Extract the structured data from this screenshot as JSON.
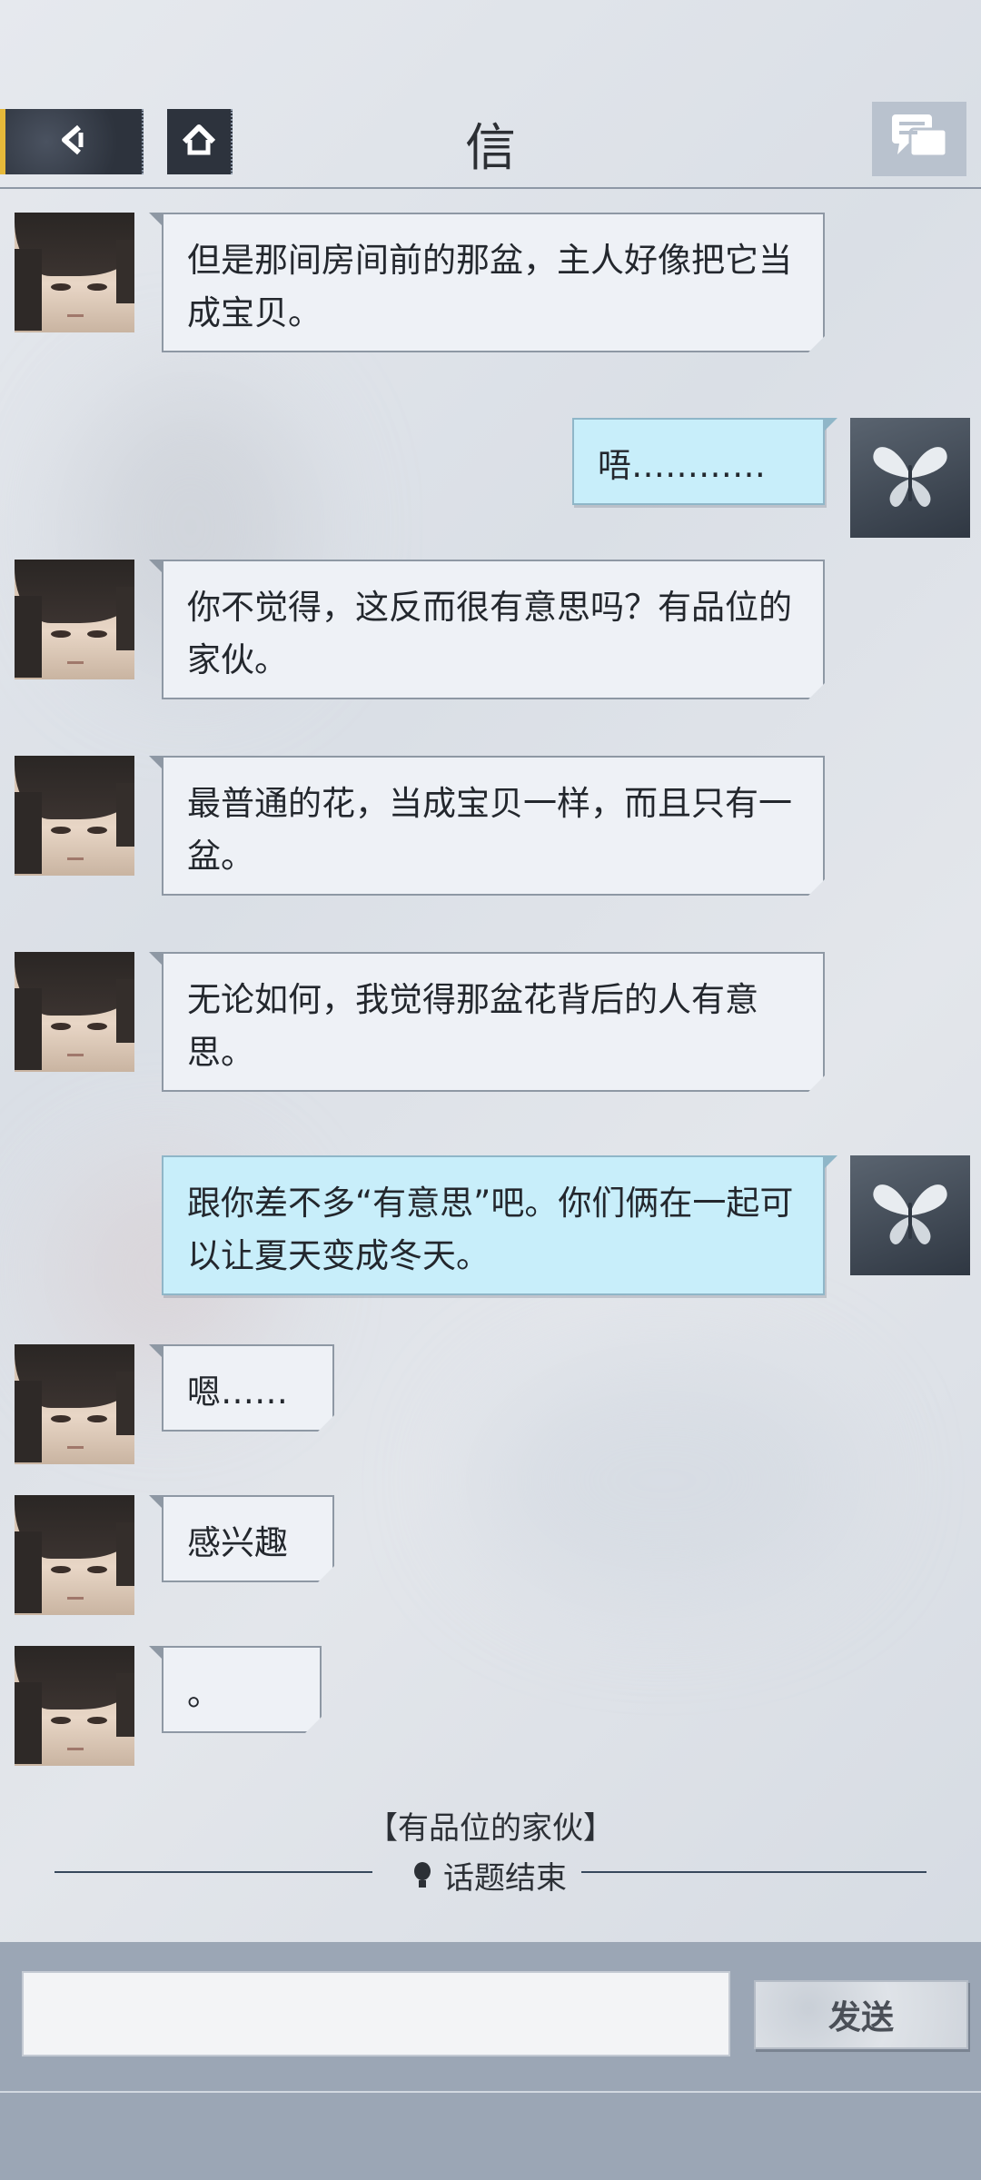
{
  "header": {
    "title": "信",
    "back_icon": "back-arrow-icon",
    "home_icon": "home-icon",
    "chat_icon": "chat-bubbles-icon"
  },
  "messages": [
    {
      "sender": "npc",
      "text": "但是那间房间前的那盆，主人好像把它当成宝贝。"
    },
    {
      "sender": "me",
      "text": "唔…………"
    },
    {
      "sender": "npc",
      "text": "你不觉得，这反而很有意思吗？有品位的家伙。"
    },
    {
      "sender": "npc",
      "text": "最普通的花，当成宝贝一样，而且只有一盆。"
    },
    {
      "sender": "npc",
      "text": "无论如何，我觉得那盆花背后的人有意思。"
    },
    {
      "sender": "me",
      "text": "跟你差不多“有意思”吧。你们俩在一起可以让夏天变成冬天。"
    },
    {
      "sender": "npc",
      "text": "嗯……"
    },
    {
      "sender": "npc",
      "text": "感兴趣"
    },
    {
      "sender": "npc",
      "text": "。"
    }
  ],
  "topic": {
    "tag": "【有品位的家伙】",
    "end_label": "话题结束"
  },
  "input": {
    "value": "",
    "placeholder": "",
    "send_label": "发送"
  },
  "colors": {
    "npc_bubble": "#eef1f6",
    "me_bubble": "#c8eefa",
    "accent": "#e6b93a",
    "input_bar": "#9ba6b5"
  }
}
